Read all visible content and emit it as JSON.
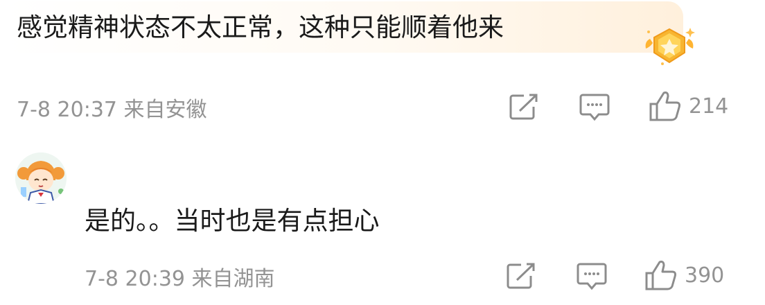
{
  "comments": [
    {
      "text": "感觉精神状态不太正常，这种只能顺着他来",
      "meta": "7-8 20:37 来自安徽",
      "likes": "214",
      "badge_icon": "star-shield-badge-icon"
    },
    {
      "text": "是的。。当时也是有点担心",
      "meta": "7-8 20:39 来自湖南",
      "likes": "390",
      "avatar_icon": "cartoon-girl-avatar"
    }
  ],
  "icons": {
    "share": "share-icon",
    "comment": "comment-icon",
    "like": "thumbs-up-icon"
  },
  "colors": {
    "text": "#1a1a1a",
    "meta": "#939393",
    "badge_gold": "#f7b531",
    "bubble_accent": "#fff0dc"
  }
}
